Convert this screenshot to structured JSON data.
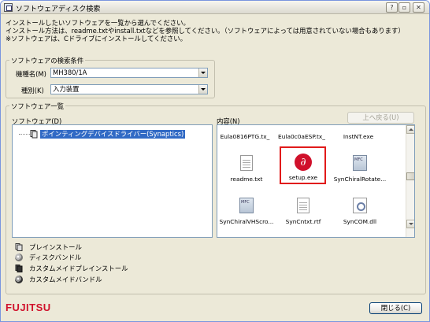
{
  "window": {
    "title": "ソフトウェアディスク検索"
  },
  "instructions": [
    "インストールしたいソフトウェアを一覧から選んでください。",
    "インストール方法は、readme.txtやinstall.txtなどを参照してください。（ソフトウェアによっては用意されていない場合もあります）",
    "※ソフトウェアは、Cドライブにインストールしてください。"
  ],
  "search": {
    "group_label": "ソフトウェアの検索条件",
    "model_label": "機種名(M)",
    "model_value": "MH380/1A",
    "type_label": "種別(K)",
    "type_value": "入力装置"
  },
  "software_list": {
    "group_label": "ソフトウェア一覧",
    "tree_label": "ソフトウェア(D)",
    "tree_item": "ポインティングデバイスドライバー(Synaptics)",
    "contents_label": "内容(N)",
    "up_button": "上へ戻る(U)",
    "files": [
      {
        "name": "Eula0816PTG.tx_",
        "icon": "none"
      },
      {
        "name": "Eula0c0aESP.tx_",
        "icon": "none"
      },
      {
        "name": "InstNT.exe",
        "icon": "none"
      },
      {
        "name": "readme.txt",
        "icon": "text-document-icon"
      },
      {
        "name": "setup.exe",
        "icon": "setup-icon"
      },
      {
        "name": "SynChiralRotate...",
        "icon": "mfc-icon"
      },
      {
        "name": "SynChiralVHScro...",
        "icon": "mfc-icon"
      },
      {
        "name": "SynCntxt.rtf",
        "icon": "text-document-icon"
      },
      {
        "name": "SynCOM.dll",
        "icon": "dll-icon"
      }
    ]
  },
  "legend": [
    {
      "label": "プレインストール",
      "icon": "preinstall-icon"
    },
    {
      "label": "ディスクバンドル",
      "icon": "disc-bundle-icon"
    },
    {
      "label": "カスタムメイドプレインストール",
      "icon": "custom-preinstall-icon"
    },
    {
      "label": "カスタムメイドバンドル",
      "icon": "custom-bundle-icon"
    }
  ],
  "close_button": "閉じる(C)",
  "brand": {
    "logo": "FUJITSU",
    "color": "#d0112b"
  },
  "colors": {
    "selection": "#316ac5",
    "highlight": "#e11a1a"
  }
}
